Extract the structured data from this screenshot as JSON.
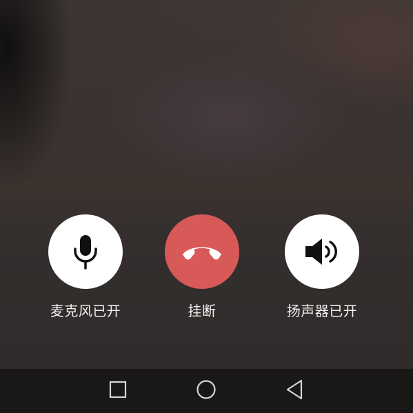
{
  "controls": {
    "mic": {
      "label": "麦克风已开",
      "icon": "microphone-icon"
    },
    "hangup": {
      "label": "挂断",
      "icon": "phone-hangup-icon"
    },
    "speaker": {
      "label": "扬声器已开",
      "icon": "speaker-icon"
    }
  },
  "navbar": {
    "recents_icon": "square-icon",
    "home_icon": "circle-icon",
    "back_icon": "triangle-back-icon"
  },
  "colors": {
    "hangup": "#d85a58",
    "control_bg": "#ffffff",
    "label_text": "#f2f0ef",
    "navbar_bg": "#1a1817",
    "nav_icon": "#d8d6d4"
  }
}
